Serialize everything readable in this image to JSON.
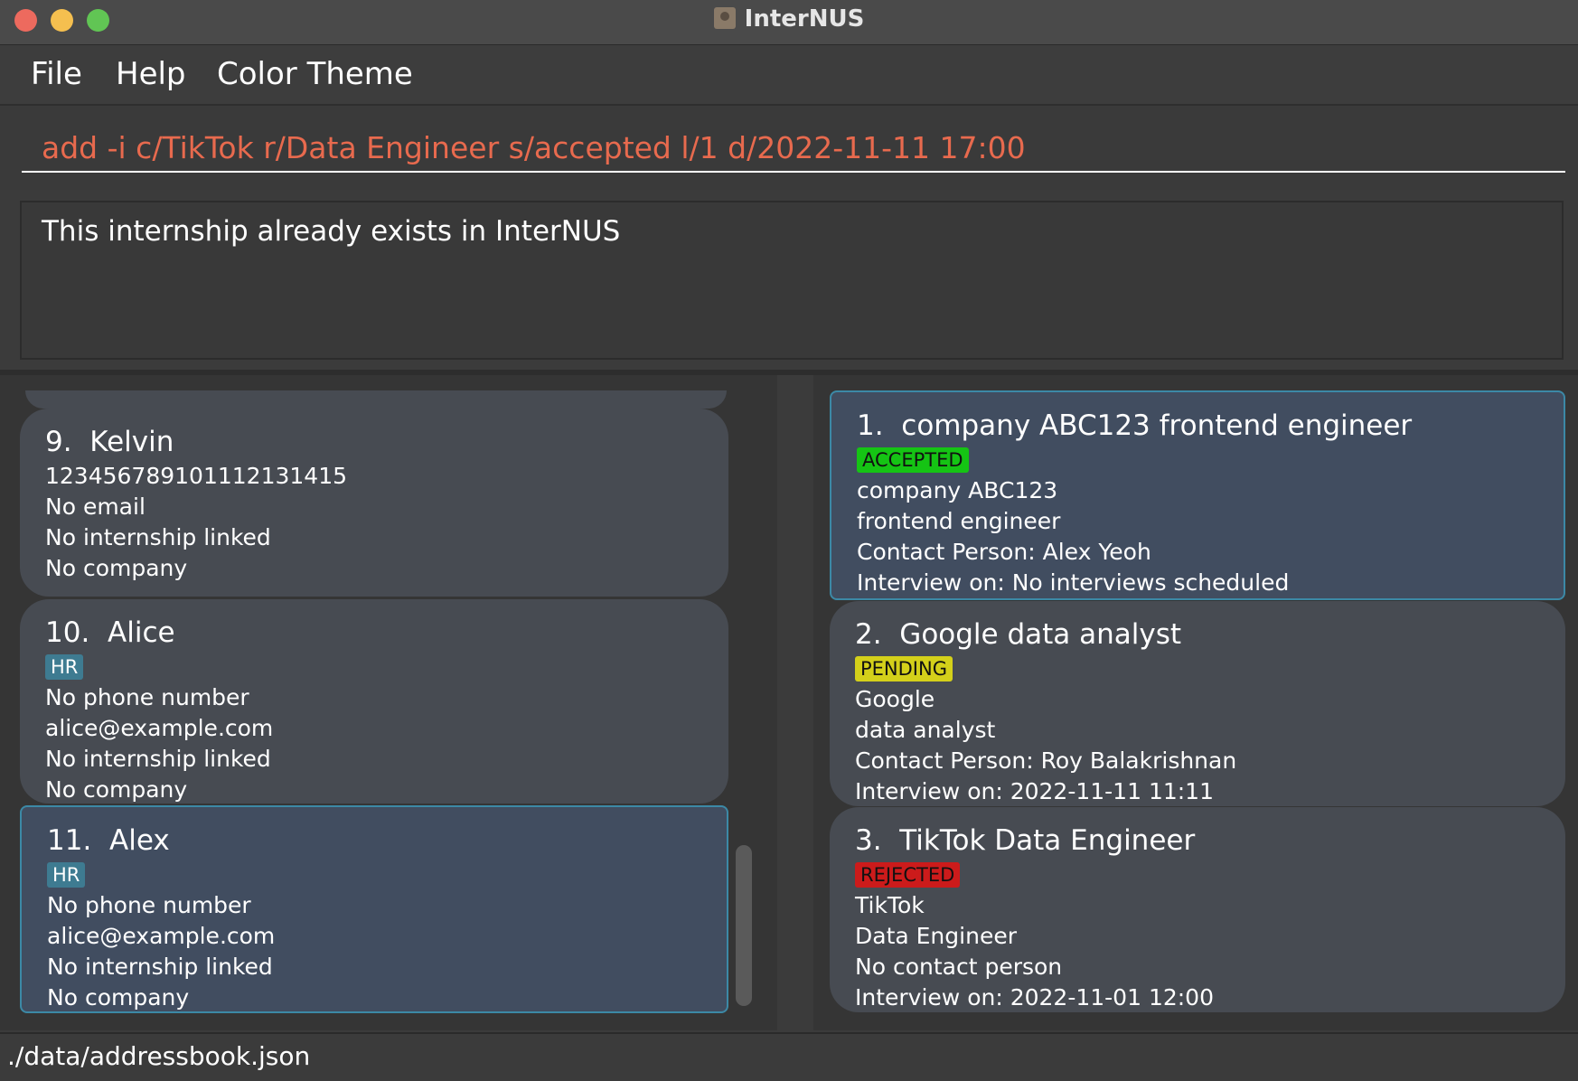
{
  "window": {
    "title": "InterNUS"
  },
  "menu": {
    "file": "File",
    "help": "Help",
    "theme": "Color Theme"
  },
  "command": {
    "value": "add -i c/TikTok r/Data Engineer s/accepted l/1 d/2022-11-11 17:00"
  },
  "result": {
    "message": "This internship already exists in InterNUS"
  },
  "persons": [
    {
      "index": "9.",
      "name": "Kelvin",
      "lines": [
        "123456789101112131415",
        "No email",
        "No internship linked",
        "No company"
      ]
    },
    {
      "index": "10.",
      "name": "Alice",
      "tag": "HR",
      "lines": [
        "No phone number",
        "alice@example.com",
        "No internship linked",
        "No company"
      ]
    },
    {
      "index": "11.",
      "name": "Alex",
      "tag": "HR",
      "lines": [
        "No phone number",
        "alice@example.com",
        "No internship linked",
        "No company"
      ]
    }
  ],
  "internships": [
    {
      "index": "1.",
      "title": "company ABC123 frontend engineer",
      "status": "ACCEPTED",
      "status_color": "#15c414",
      "company": "company ABC123",
      "role": "frontend engineer",
      "contact": "Contact Person: Alex Yeoh",
      "interview": "Interview on: No interviews scheduled"
    },
    {
      "index": "2.",
      "title": "Google data analyst",
      "status": "PENDING",
      "status_color": "#d4d01a",
      "company": "Google",
      "role": "data analyst",
      "contact": "Contact Person: Roy Balakrishnan",
      "interview": "Interview on: 2022-11-11 11:11"
    },
    {
      "index": "3.",
      "title": "TikTok Data Engineer",
      "status": "REJECTED",
      "status_color": "#cc1b1b",
      "company": "TikTok",
      "role": "Data Engineer",
      "contact": "No contact person",
      "interview": "Interview on: 2022-11-01 12:00"
    }
  ],
  "status_bar": {
    "path": "./data/addressbook.json"
  }
}
